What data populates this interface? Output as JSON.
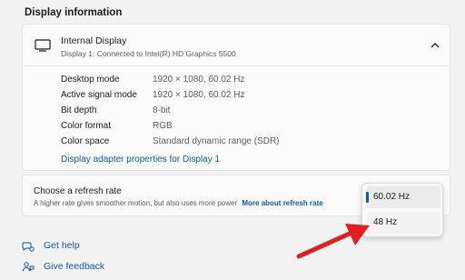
{
  "section_title": "Display information",
  "display": {
    "title": "Internal Display",
    "subtitle": "Display 1: Connected to Intel(R) HD Graphics 5500",
    "icon": "monitor-icon",
    "rows": [
      {
        "label": "Desktop mode",
        "value": "1920 × 1080, 60.02 Hz"
      },
      {
        "label": "Active signal mode",
        "value": "1920 × 1080, 60.02 Hz"
      },
      {
        "label": "Bit depth",
        "value": "8-bit"
      },
      {
        "label": "Color format",
        "value": "RGB"
      },
      {
        "label": "Color space",
        "value": "Standard dynamic range (SDR)"
      }
    ],
    "adapter_link": "Display adapter properties for Display 1"
  },
  "refresh": {
    "title": "Choose a refresh rate",
    "description": "A higher rate gives smoother motion, but also uses more power",
    "more_link": "More about refresh rate",
    "options": [
      "60.02 Hz",
      "48 Hz"
    ],
    "selected": "60.02 Hz"
  },
  "help": {
    "get_help": "Get help",
    "give_feedback": "Give feedback"
  },
  "colors": {
    "accent": "#0f5aa3",
    "annotation_arrow": "#e02020"
  }
}
